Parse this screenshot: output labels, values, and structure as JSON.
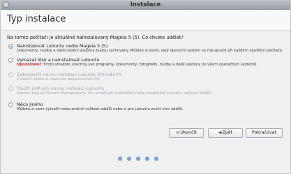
{
  "window": {
    "title": "Instalace"
  },
  "header": {
    "title": "Typ instalace"
  },
  "question": "Na tomto počítači je aktuálně nainstalovaný Mageia 5 (5). Co chcete udělat?",
  "options": [
    {
      "label": "Nainstalovat Lubuntu vedle Mageia 5 (5)",
      "description": "Dokumenty, hudba a další osobní soubory budou zachovány. Můžete si zvolit, jaký operační systém se má spustit při každém spuštění počítače.",
      "checked": true,
      "enabled": true
    },
    {
      "label": "Vymazat disk a nainstalovat Lubuntu",
      "warning": "Upozornění:",
      "description": "Tímto smažete všechny své programy, dokumenty, fotografie, hudbu a další soubory ze všech operačních systémů.",
      "checked": false,
      "enabled": true
    },
    {
      "label": "Zabezpečit novou instalaci Lubuntu šifrováním",
      "description": "V dalším kroku si nastavíte bezpečnostní klíč.",
      "checked": false,
      "enabled": false
    },
    {
      "label": "Použít LVM pro novou instalaci Lubuntu",
      "description": "Nastaví Logical Volume Management. Ten umožňuje snadnější tvorbu snapshotů a změnu velikostí oddílů.",
      "checked": false,
      "enabled": false
    },
    {
      "label": "Něco jiného",
      "description": "Můžete si sami vytvořit nebo změnit velikost oddílů nebo si pro Lubuntu zvolit více oddílů.",
      "checked": false,
      "enabled": true
    }
  ],
  "buttons": {
    "quit": "Ukončit",
    "back": "Zpět",
    "next": "Pokračovat"
  },
  "icons": {
    "quit": "stop-icon",
    "back": "arrow-left-icon"
  },
  "progress": {
    "total_steps": 5
  },
  "colors": {
    "accent": "#3a74c4",
    "warning": "#cc2222",
    "dot": "#7a9fd2"
  }
}
